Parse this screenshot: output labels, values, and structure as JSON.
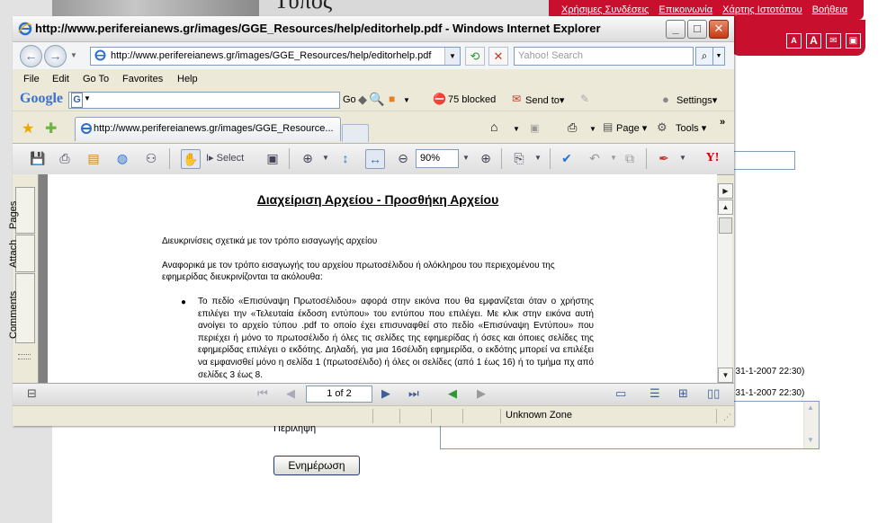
{
  "background_page": {
    "heading": "Τύπος",
    "top_links": [
      "Χρήσιμες Συνδέσεις",
      "Επικοινωνία",
      "Χάρτης Ιστοτόπου",
      "Βοήθεια"
    ],
    "accessibility_icons": [
      "A",
      "A",
      "✉",
      "▣"
    ],
    "entry_meta_1": ", 31-1-2007 22:30)",
    "entry_meta_2": ", 31-1-2007 22:30)",
    "summary_label": "Περίληψη",
    "update_button": "Ενημέρωση"
  },
  "window": {
    "title": "http://www.perifereianews.gr/images/GGE_Resources/help/editorhelp.pdf - Windows Internet Explorer",
    "address": "http://www.perifereianews.gr/images/GGE_Resources/help/editorhelp.pdf",
    "search_placeholder": "Yahoo! Search",
    "menu": [
      "File",
      "Edit",
      "Go To",
      "Favorites",
      "Help"
    ],
    "google_toolbar": {
      "logo": "Google",
      "go_label": "Go",
      "popups_blocked": "75 blocked",
      "send_to": "Send to▾",
      "settings": "Settings▾"
    },
    "tab_label": "http://www.perifereianews.gr/images/GGE_Resource...",
    "commands": {
      "page": "Page ▾",
      "tools": "Tools ▾"
    },
    "reader_toolbar": {
      "select_label": "Select",
      "zoom": "90%"
    },
    "side_tabs": [
      "Pages",
      "Attach",
      "Comments"
    ],
    "status_zone": "Unknown Zone"
  },
  "document": {
    "title": "Διαχείριση Αρχείου - Προσθήκη Αρχείου",
    "para1": "Διευκρινίσεις σχετικά με τον τρόπο εισαγωγής αρχείου",
    "para2": "Αναφορικά με τον τρόπο εισαγωγής του αρχείου πρωτοσέλιδου ή ολόκληρου του περιεχομένου της εφημερίδας διευκρινίζονται τα ακόλουθα:",
    "bullet1": "Το πεδίο «Επισύναψη Πρωτοσέλιδου» αφορά στην εικόνα που θα εμφανίζεται όταν ο χρήστης επιλέγει την «Τελευταία έκδοση εντύπου» του εντύπου που επιλέγει. Με κλικ στην εικόνα αυτή ανοίγει το αρχείο τύπου .pdf το οποίο έχει επισυναφθεί στο πεδίο «Επισύναψη Εντύπου» που περιέχει ή μόνο το πρωτοσέλιδο ή όλες τις σελίδες της εφημερίδας ή όσες και όποιες σελίδες της εφημερίδας επιλέγει ο εκδότης. Δηλαδή, για μια 16σέλιδη εφημερίδα, ο εκδότης μπορεί να επιλέξει να εμφανισθεί μόνο η σελίδα 1 (πρωτοσέλιδο) ή όλες οι σελίδες (από 1 έως 16) ή το τμήμα πχ από σελίδες 3 έως 8."
  },
  "pager": {
    "current": "1 of 2"
  },
  "colors": {
    "brand_red": "#c8102e",
    "window_chrome": "#ece9d8",
    "link_blue": "#3c5f96"
  }
}
